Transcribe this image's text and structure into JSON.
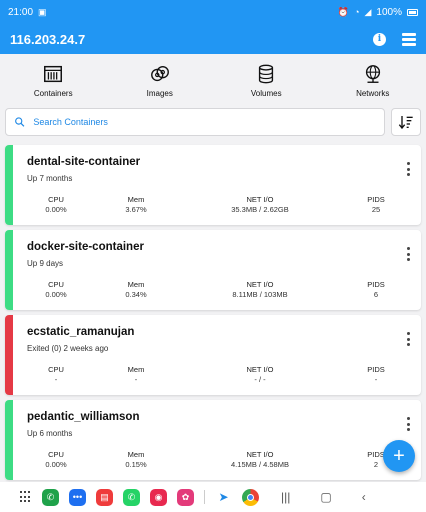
{
  "statusbar": {
    "time": "21:00",
    "battery": "100%"
  },
  "appbar": {
    "title": "116.203.24.7"
  },
  "nav": [
    {
      "label": "Containers",
      "icon": "containers-icon"
    },
    {
      "label": "Images",
      "icon": "images-icon"
    },
    {
      "label": "Volumes",
      "icon": "volumes-icon"
    },
    {
      "label": "Networks",
      "icon": "networks-icon"
    }
  ],
  "search": {
    "placeholder": "Search Containers"
  },
  "stat_labels": {
    "cpu": "CPU",
    "mem": "Mem",
    "netio": "NET I/O",
    "pids": "PIDS"
  },
  "containers": [
    {
      "name": "dental-site-container",
      "status": "Up 7 months",
      "color": "#3ddc84",
      "cpu": "0.00%",
      "mem": "3.67%",
      "netio": "35.3MB / 2.62GB",
      "pids": "25"
    },
    {
      "name": "docker-site-container",
      "status": "Up 9 days",
      "color": "#3ddc84",
      "cpu": "0.00%",
      "mem": "0.34%",
      "netio": "8.11MB / 103MB",
      "pids": "6"
    },
    {
      "name": "ecstatic_ramanujan",
      "status": "Exited (0) 2 weeks ago",
      "color": "#e53945",
      "cpu": "-",
      "mem": "-",
      "netio": "- / -",
      "pids": "-"
    },
    {
      "name": "pedantic_williamson",
      "status": "Up 6 months",
      "color": "#3ddc84",
      "cpu": "0.00%",
      "mem": "0.15%",
      "netio": "4.15MB / 4.58MB",
      "pids": "2"
    }
  ],
  "colors": {
    "primary": "#2196f3",
    "running": "#3ddc84",
    "exited": "#e53945"
  }
}
